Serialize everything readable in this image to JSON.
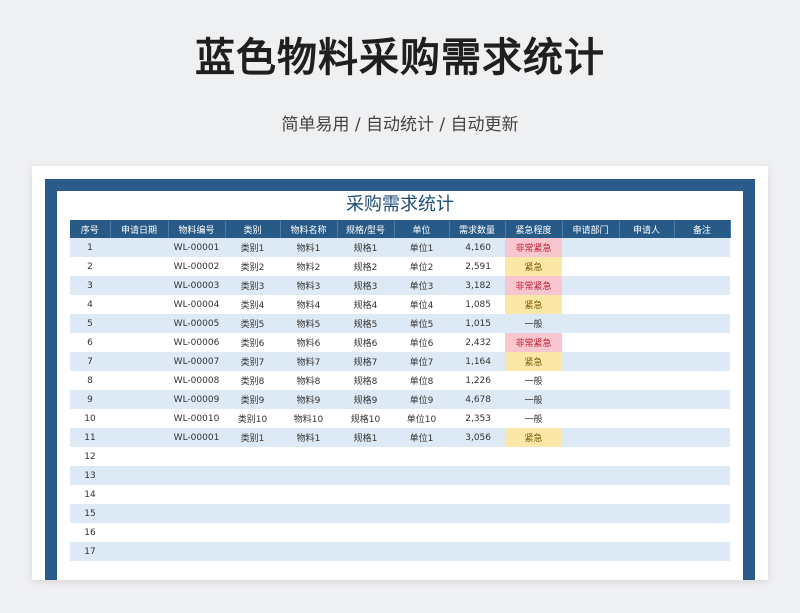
{
  "page_title": "蓝色物料采购需求统计",
  "subtitle": "简单易用 / 自动统计 / 自动更新",
  "sheet": {
    "title": "采购需求统计",
    "columns": [
      "序号",
      "申请日期",
      "物料编号",
      "类别",
      "物料名称",
      "规格/型号",
      "单位",
      "需求数量",
      "紧急程度",
      "申请部门",
      "申请人",
      "备注"
    ],
    "rows": [
      [
        "1",
        "",
        "WL-00001",
        "类别1",
        "物料1",
        "规格1",
        "单位1",
        "4,160",
        "非常紧急",
        "",
        "",
        ""
      ],
      [
        "2",
        "",
        "WL-00002",
        "类别2",
        "物料2",
        "规格2",
        "单位2",
        "2,591",
        "紧急",
        "",
        "",
        ""
      ],
      [
        "3",
        "",
        "WL-00003",
        "类别3",
        "物料3",
        "规格3",
        "单位3",
        "3,182",
        "非常紧急",
        "",
        "",
        ""
      ],
      [
        "4",
        "",
        "WL-00004",
        "类别4",
        "物料4",
        "规格4",
        "单位4",
        "1,085",
        "紧急",
        "",
        "",
        ""
      ],
      [
        "5",
        "",
        "WL-00005",
        "类别5",
        "物料5",
        "规格5",
        "单位5",
        "1,015",
        "一般",
        "",
        "",
        ""
      ],
      [
        "6",
        "",
        "WL-00006",
        "类别6",
        "物料6",
        "规格6",
        "单位6",
        "2,432",
        "非常紧急",
        "",
        "",
        ""
      ],
      [
        "7",
        "",
        "WL-00007",
        "类别7",
        "物料7",
        "规格7",
        "单位7",
        "1,164",
        "紧急",
        "",
        "",
        ""
      ],
      [
        "8",
        "",
        "WL-00008",
        "类别8",
        "物料8",
        "规格8",
        "单位8",
        "1,226",
        "一般",
        "",
        "",
        ""
      ],
      [
        "9",
        "",
        "WL-00009",
        "类别9",
        "物料9",
        "规格9",
        "单位9",
        "4,678",
        "一般",
        "",
        "",
        ""
      ],
      [
        "10",
        "",
        "WL-00010",
        "类别10",
        "物料10",
        "规格10",
        "单位10",
        "2,353",
        "一般",
        "",
        "",
        ""
      ],
      [
        "11",
        "",
        "WL-00001",
        "类别1",
        "物料1",
        "规格1",
        "单位1",
        "3,056",
        "紧急",
        "",
        "",
        ""
      ],
      [
        "12",
        "",
        "",
        "",
        "",
        "",
        "",
        "",
        "",
        "",
        "",
        ""
      ],
      [
        "13",
        "",
        "",
        "",
        "",
        "",
        "",
        "",
        "",
        "",
        "",
        ""
      ],
      [
        "14",
        "",
        "",
        "",
        "",
        "",
        "",
        "",
        "",
        "",
        "",
        ""
      ],
      [
        "15",
        "",
        "",
        "",
        "",
        "",
        "",
        "",
        "",
        "",
        "",
        ""
      ],
      [
        "16",
        "",
        "",
        "",
        "",
        "",
        "",
        "",
        "",
        "",
        "",
        ""
      ],
      [
        "17",
        "",
        "",
        "",
        "",
        "",
        "",
        "",
        "",
        "",
        "",
        ""
      ]
    ]
  },
  "colors": {
    "header_bg": "#285a88",
    "frame": "#2b5b8a",
    "stripe": "#dde9f5",
    "urgency_very_urgent": "#f7c6cf",
    "urgency_urgent": "#fbe7a7"
  }
}
